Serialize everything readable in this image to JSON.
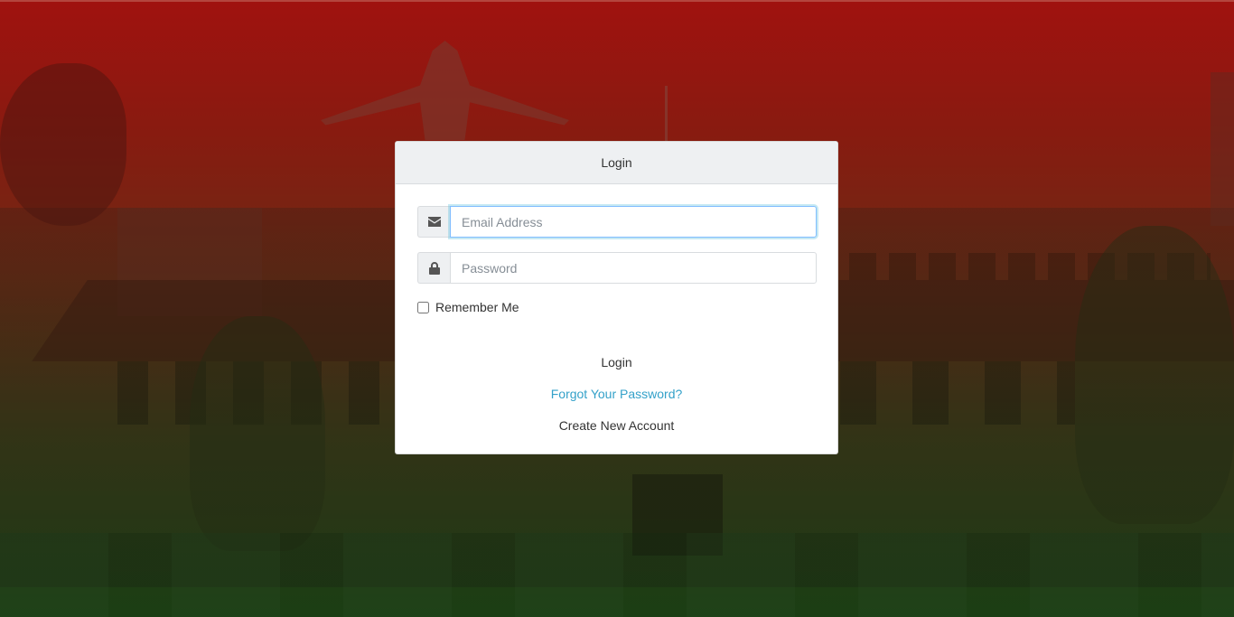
{
  "login_card": {
    "header_title": "Login",
    "email": {
      "placeholder": "Email Address",
      "value": "",
      "icon": "envelope-icon"
    },
    "password": {
      "placeholder": "Password",
      "value": "",
      "icon": "lock-icon"
    },
    "remember_me": {
      "label": "Remember Me",
      "checked": false
    },
    "login_button_label": "Login",
    "forgot_password_label": "Forgot Your Password?",
    "create_account_label": "Create New Account"
  },
  "colors": {
    "accent_link": "#33a1c9",
    "background_top": "#a0120f",
    "background_bottom": "#1f4a17",
    "card_header_bg": "#eef0f2",
    "focus_ring": "#80bdff"
  }
}
